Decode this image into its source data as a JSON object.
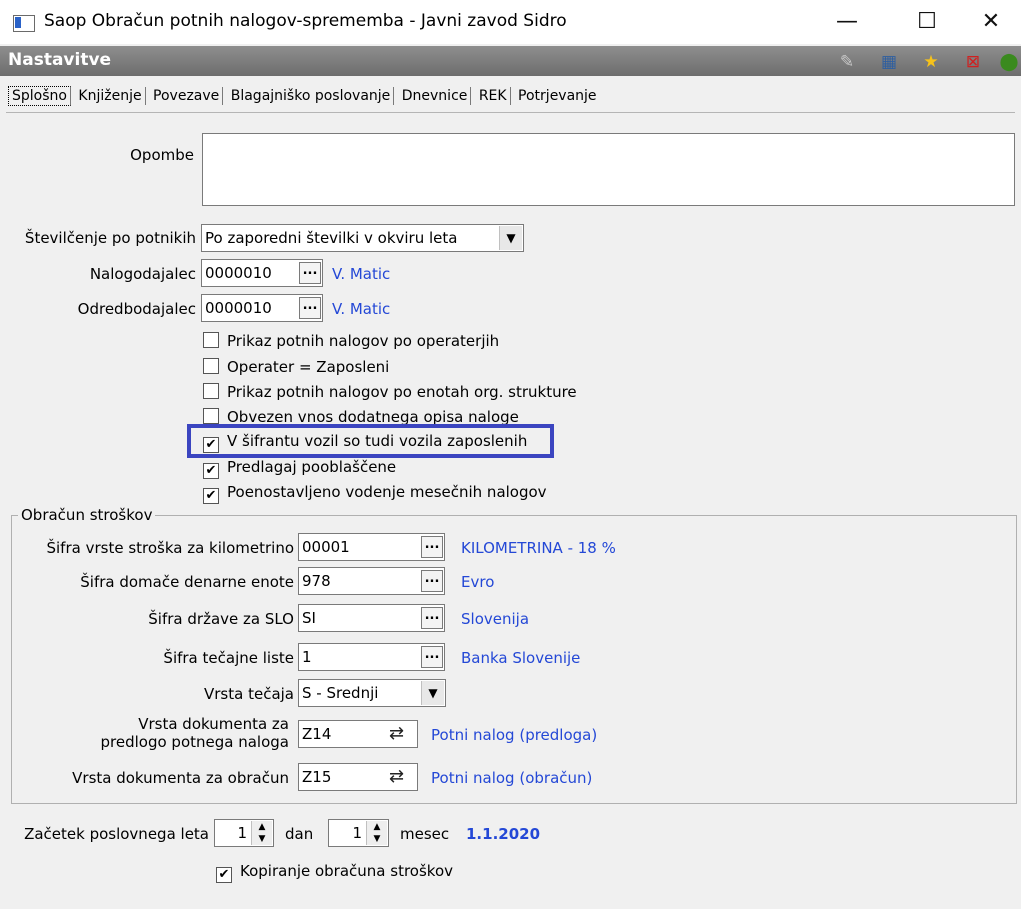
{
  "window": {
    "title": "Saop Obračun potnih nalogov-sprememba - Javni zavod Sidro",
    "minimize": "—",
    "maximize": "☐",
    "close": "✕"
  },
  "header": {
    "title": "Nastavitve"
  },
  "tabs": [
    "Splošno",
    "Knjiženje",
    "Povezave",
    "Blagajniško poslovanje",
    "Dnevnice",
    "REK",
    "Potrjevanje"
  ],
  "form": {
    "opombe_label": "Opombe",
    "opombe_value": "",
    "stevilcenje_label": "Številčenje po potnikih",
    "stevilcenje_value": "Po zaporedni številki v okviru leta",
    "nalogodajalec_label": "Nalogodajalec",
    "nalogodajalec_value": "0000010",
    "nalogodajalec_name": "V. Matic",
    "odredbodajalec_label": "Odredbodajalec",
    "odredbodajalec_value": "0000010",
    "odredbodajalec_name": "V. Matic"
  },
  "checkboxes": [
    {
      "label": "Prikaz potnih nalogov po operaterjih",
      "checked": false
    },
    {
      "label": "Operater = Zaposleni",
      "checked": false
    },
    {
      "label": "Prikaz potnih nalogov po enotah org. strukture",
      "checked": false
    },
    {
      "label": "Obvezen vnos dodatnega opisa naloge",
      "checked": false
    },
    {
      "label": "V šifrantu vozil  so tudi vozila zaposlenih",
      "checked": true
    },
    {
      "label": "Predlagaj pooblaščene",
      "checked": true
    },
    {
      "label": "Poenostavljeno vodenje mesečnih nalogov",
      "checked": true
    }
  ],
  "costs": {
    "group_title": "Obračun stroškov",
    "km_label": "Šifra vrste stroška za kilometrino",
    "km_value": "00001",
    "km_name": "KILOMETRINA - 18 %",
    "currency_label": "Šifra domače denarne enote",
    "currency_value": "978",
    "currency_name": "Evro",
    "country_label": "Šifra države za SLO",
    "country_value": "SI",
    "country_name": "Slovenija",
    "rates_label": "Šifra tečajne liste",
    "rates_value": "1",
    "rates_name": "Banka Slovenije",
    "rate_type_label": "Vrsta tečaja",
    "rate_type_value": "S - Srednji",
    "doc_template_label_1": "Vrsta dokumenta za",
    "doc_template_label_2": "predlogo potnega naloga",
    "doc_template_value": "Z14",
    "doc_template_name": "Potni nalog (predloga)",
    "doc_calc_label": "Vrsta dokumenta za obračun",
    "doc_calc_value": "Z15",
    "doc_calc_name": "Potni nalog (obračun)"
  },
  "year": {
    "label": "Začetek poslovnega leta",
    "day_value": "1",
    "day_label": "dan",
    "month_value": "1",
    "month_label": "mesec",
    "date": "1.1.2020"
  },
  "copy_check": {
    "label": "Kopiranje obračuna stroškov",
    "checked": true
  }
}
